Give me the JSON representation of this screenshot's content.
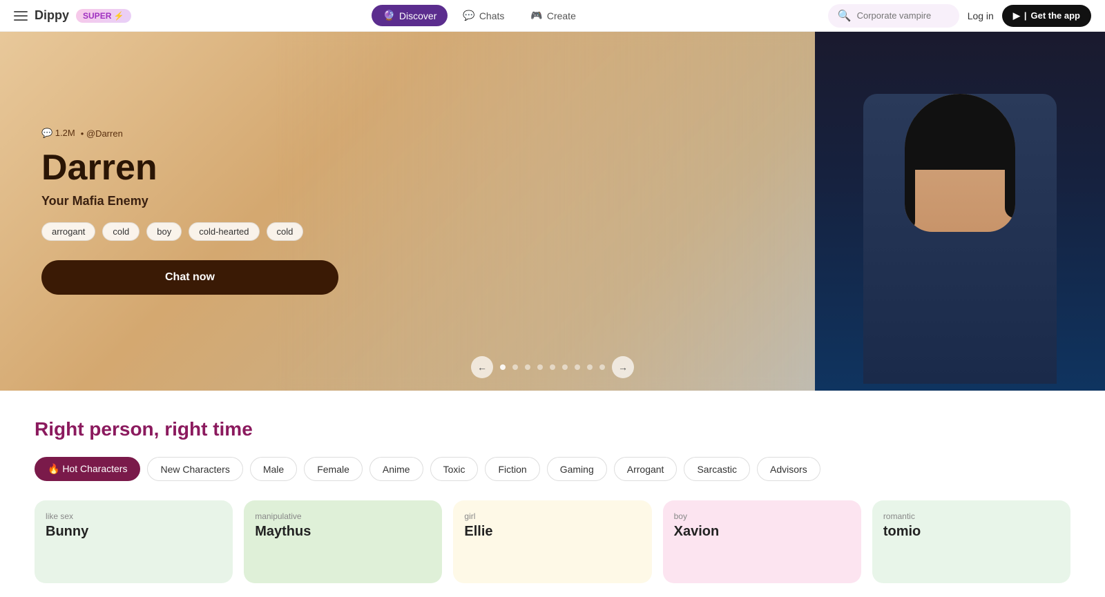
{
  "app": {
    "logo": "Dippy",
    "super_badge": "SUPER ⚡"
  },
  "navbar": {
    "hamburger_label": "menu",
    "discover_label": "Discover",
    "chats_label": "Chats",
    "create_label": "Create",
    "search_placeholder": "Corporate vampire",
    "login_label": "Log in",
    "get_app_label": "Get the app"
  },
  "hero": {
    "stat": "💬 1.2M",
    "author": "• @Darren",
    "title": "Darren",
    "subtitle": "Your Mafia Enemy",
    "tags": [
      "arrogant",
      "cold",
      "boy",
      "cold-hearted",
      "cold"
    ],
    "cta": "Chat now",
    "carousel_dots": 9,
    "active_dot": 0
  },
  "section": {
    "title": "Right person, right time"
  },
  "filters": [
    {
      "label": "🔥 Hot Characters",
      "active": true
    },
    {
      "label": "New Characters",
      "active": false
    },
    {
      "label": "Male",
      "active": false
    },
    {
      "label": "Female",
      "active": false
    },
    {
      "label": "Anime",
      "active": false
    },
    {
      "label": "Toxic",
      "active": false
    },
    {
      "label": "Fiction",
      "active": false
    },
    {
      "label": "Gaming",
      "active": false
    },
    {
      "label": "Arrogant",
      "active": false
    },
    {
      "label": "Sarcastic",
      "active": false
    },
    {
      "label": "Advisors",
      "active": false
    }
  ],
  "cards": [
    {
      "tag": "like sex",
      "name": "Bunny",
      "color": "green"
    },
    {
      "tag": "manipulative",
      "name": "Maythus",
      "color": "green2"
    },
    {
      "tag": "girl",
      "name": "Ellie",
      "color": "yellow"
    },
    {
      "tag": "boy",
      "name": "Xavion",
      "color": "pink"
    },
    {
      "tag": "romantic",
      "name": "tomio",
      "color": "lightgreen"
    }
  ]
}
